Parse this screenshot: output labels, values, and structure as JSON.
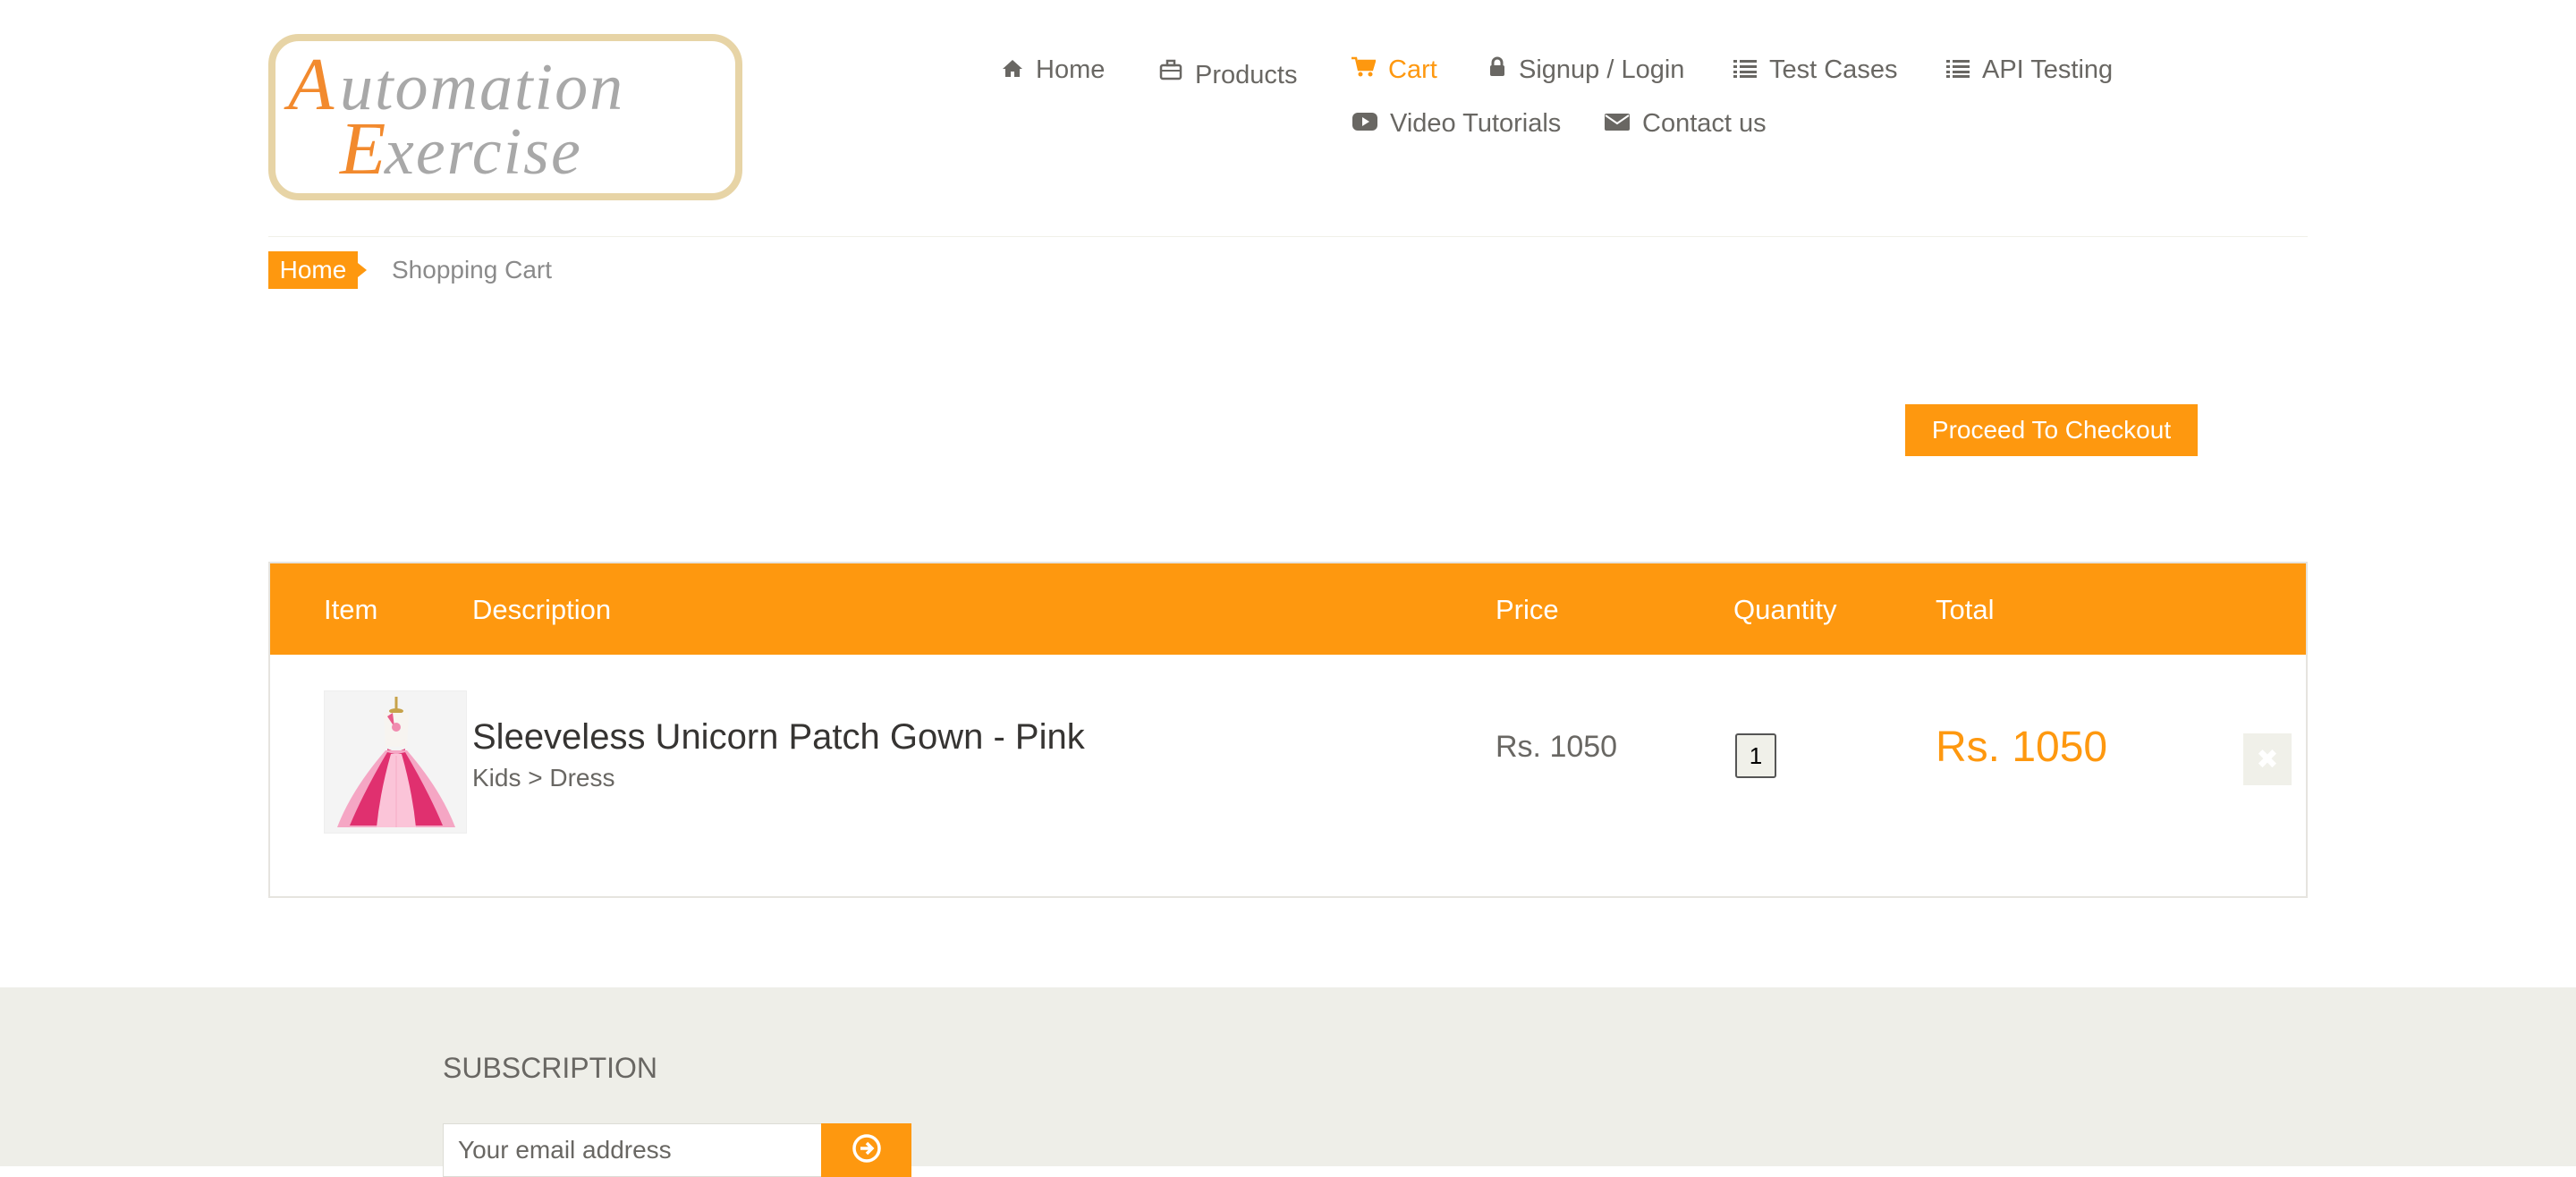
{
  "header": {
    "logo_text_line1": "Automation",
    "logo_text_line2": "Exercise",
    "nav": {
      "home": "Home",
      "products": "Products",
      "cart": "Cart",
      "signup_login": "Signup / Login",
      "test_cases": "Test Cases",
      "api_testing": "API Testing",
      "video_tutorials": "Video Tutorials",
      "contact_us": "Contact us"
    },
    "active_nav": "cart"
  },
  "breadcrumb": {
    "home": "Home",
    "current": "Shopping Cart"
  },
  "checkout_button": "Proceed To Checkout",
  "cart": {
    "columns": {
      "item": "Item",
      "description": "Description",
      "price": "Price",
      "quantity": "Quantity",
      "total": "Total"
    },
    "rows": [
      {
        "name": "Sleeveless Unicorn Patch Gown - Pink",
        "category": "Kids > Dress",
        "price": "Rs. 1050",
        "quantity": "1",
        "total": "Rs. 1050"
      }
    ]
  },
  "footer": {
    "subscription_title": "SUBSCRIPTION",
    "email_placeholder": "Your email address"
  },
  "colors": {
    "accent": "#fe980f",
    "footer_bg": "#eeeee8",
    "text": "#696763"
  }
}
